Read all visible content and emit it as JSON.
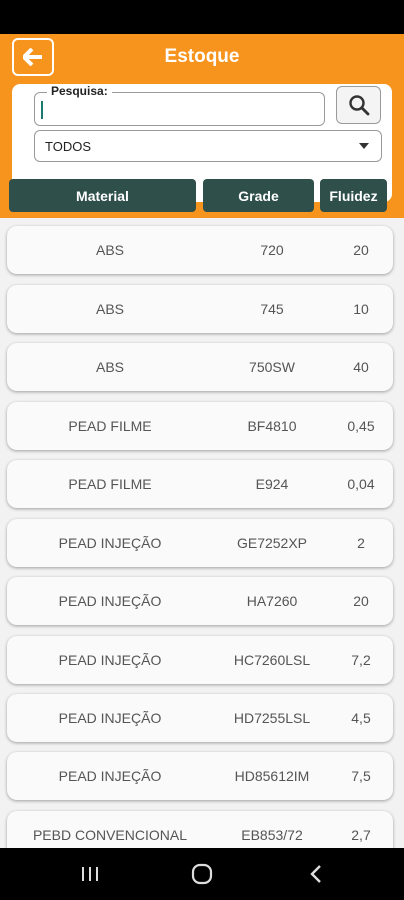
{
  "header": {
    "title": "Estoque"
  },
  "search": {
    "label": "Pesquisa:",
    "value": "",
    "placeholder": ""
  },
  "filter": {
    "selected": "TODOS"
  },
  "columns": {
    "material": "Material",
    "grade": "Grade",
    "fluidez": "Fluidez"
  },
  "rows": [
    {
      "material": "ABS",
      "grade": "720",
      "fluidez": "20"
    },
    {
      "material": "ABS",
      "grade": "745",
      "fluidez": "10"
    },
    {
      "material": "ABS",
      "grade": "750SW",
      "fluidez": "40"
    },
    {
      "material": "PEAD FILME",
      "grade": "BF4810",
      "fluidez": "0,45"
    },
    {
      "material": "PEAD FILME",
      "grade": "E924",
      "fluidez": "0,04"
    },
    {
      "material": "PEAD INJEÇÃO",
      "grade": "GE7252XP",
      "fluidez": "2"
    },
    {
      "material": "PEAD INJEÇÃO",
      "grade": "HA7260",
      "fluidez": "20"
    },
    {
      "material": "PEAD INJEÇÃO",
      "grade": "HC7260LSL",
      "fluidez": "7,2"
    },
    {
      "material": "PEAD INJEÇÃO",
      "grade": "HD7255LSL",
      "fluidez": "4,5"
    },
    {
      "material": "PEAD INJEÇÃO",
      "grade": "HD85612IM",
      "fluidez": "7,5"
    },
    {
      "material": "PEBD CONVENCIONAL",
      "grade": "EB853/72",
      "fluidez": "2,7"
    }
  ],
  "colors": {
    "accent": "#f7941d",
    "header_cell": "#2f4f4a"
  },
  "icons": {
    "back": "arrow-left-icon",
    "search": "magnifier-icon",
    "dropdown": "triangle-down-icon"
  }
}
